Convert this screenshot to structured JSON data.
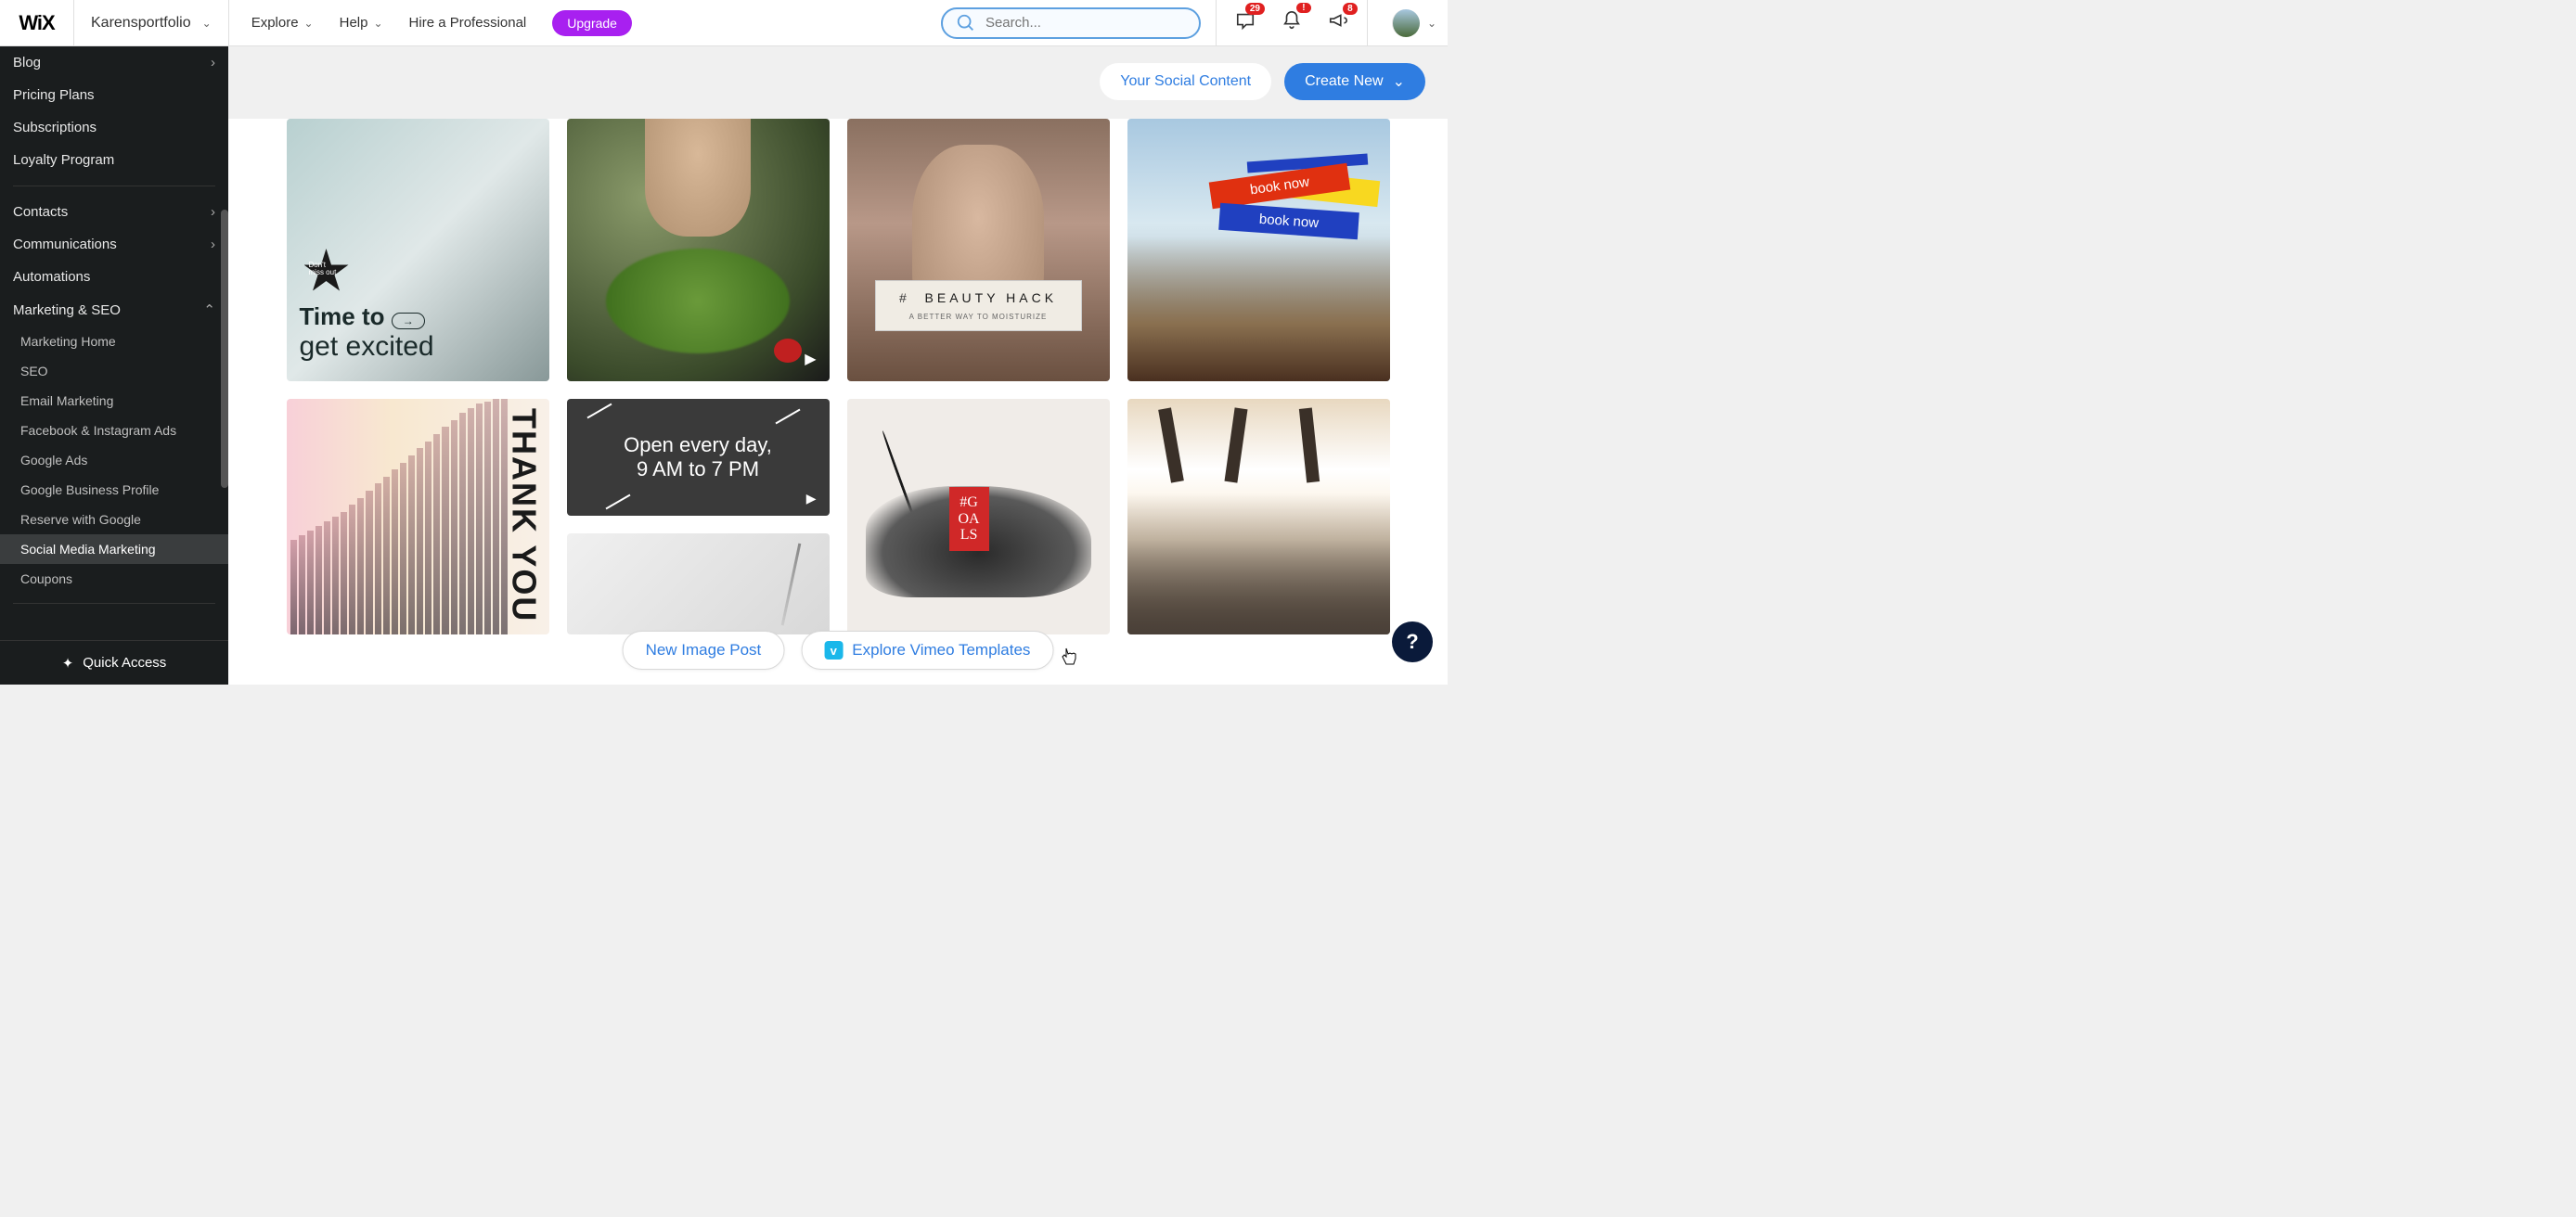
{
  "topbar": {
    "logo": "WiX",
    "site_name": "Karensportfolio",
    "nav": {
      "explore": "Explore",
      "help": "Help",
      "hire": "Hire a Professional"
    },
    "upgrade": "Upgrade",
    "search_placeholder": "Search...",
    "badges": {
      "inbox": "29",
      "alert": "!",
      "bell": "8"
    }
  },
  "sidebar": {
    "items_top": [
      {
        "label": "Blog",
        "chev": true
      },
      {
        "label": "Pricing Plans"
      },
      {
        "label": "Subscriptions"
      },
      {
        "label": "Loyalty Program"
      }
    ],
    "items_mid": [
      {
        "label": "Contacts",
        "chev": true
      },
      {
        "label": "Communications",
        "chev": true
      },
      {
        "label": "Automations"
      },
      {
        "label": "Marketing & SEO",
        "chev": true,
        "open": true
      }
    ],
    "subs": [
      "Marketing Home",
      "SEO",
      "Email Marketing",
      "Facebook & Instagram Ads",
      "Google Ads",
      "Google Business Profile",
      "Reserve with Google",
      "Social Media Marketing",
      "Coupons"
    ],
    "active_sub": "Social Media Marketing",
    "quick_access": "Quick Access"
  },
  "actions": {
    "social_content": "Your Social Content",
    "create_new": "Create New"
  },
  "templates": {
    "t1": {
      "star": "Don't\nmiss out",
      "h1": "Time to",
      "h2": "get excited"
    },
    "t3": {
      "big": "BEAUTY HACK",
      "small": "A BETTER WAY TO MOISTURIZE"
    },
    "t4": {
      "tk1": "book now",
      "tk2": "book now"
    },
    "t5": {
      "text": "THANK YOU"
    },
    "t6": {
      "l1": "Open every day,",
      "l2": "9 AM to 7 PM"
    },
    "t7": {
      "text": "#G\nOA\nLS"
    }
  },
  "bottom": {
    "new_image": "New Image Post",
    "vimeo": "Explore Vimeo Templates"
  },
  "help_fab": "?"
}
